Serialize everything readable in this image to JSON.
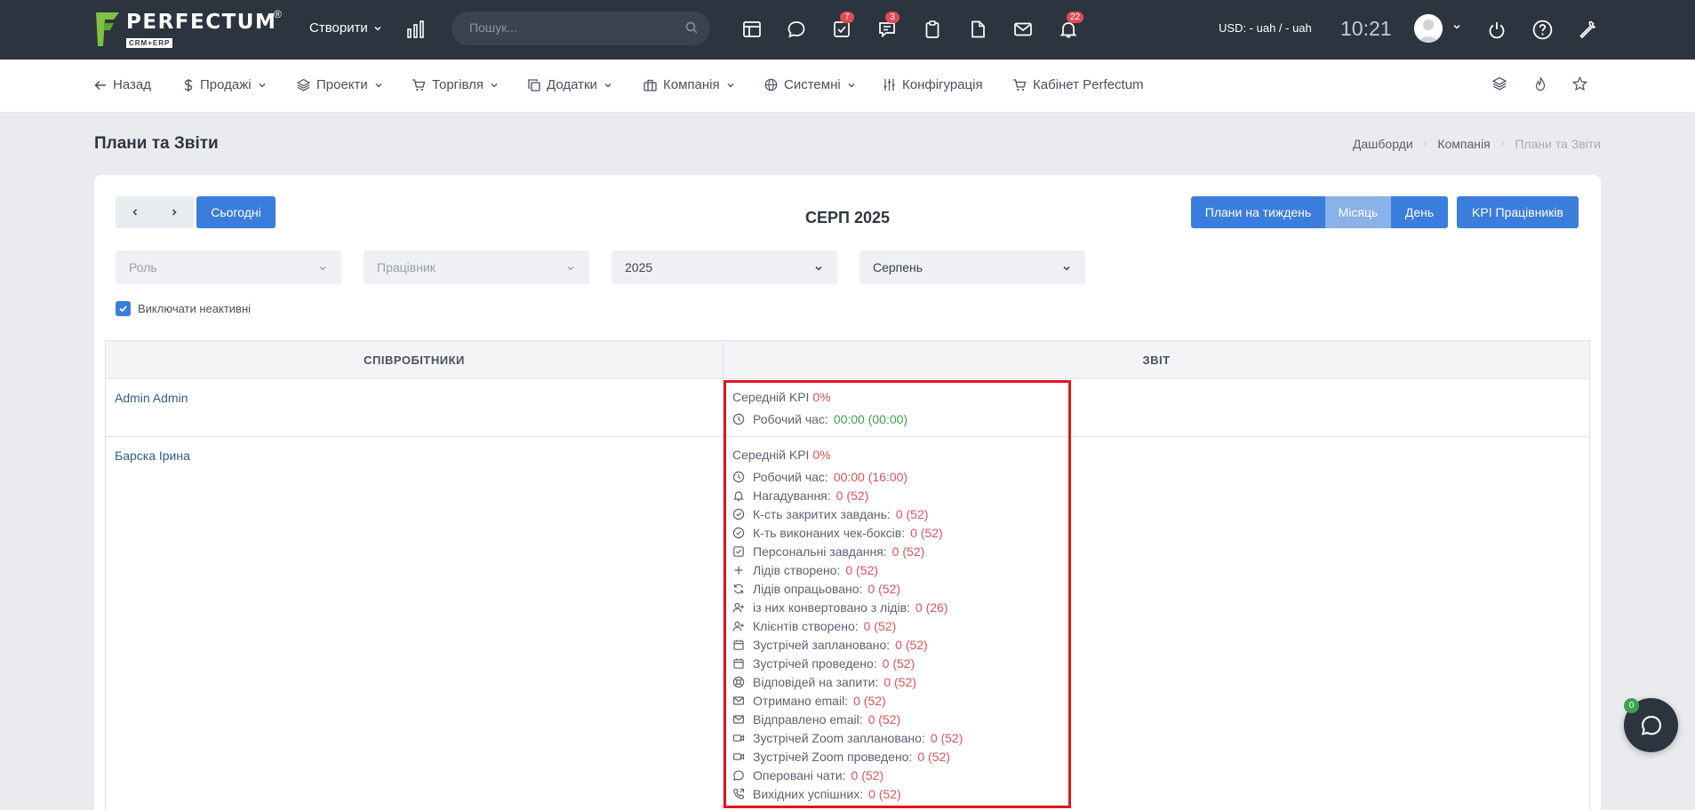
{
  "topbar": {
    "logo_text": "PERFECTUM",
    "logo_reg": "®",
    "logo_sub": "CRM+ERP",
    "create_label": "Створити",
    "search_placeholder": "Пошук...",
    "icons": [
      {
        "name": "table-icon",
        "badge": ""
      },
      {
        "name": "chat-bubble-icon",
        "badge": ""
      },
      {
        "name": "task-check-icon",
        "badge": "7"
      },
      {
        "name": "discussion-icon",
        "badge": "3"
      },
      {
        "name": "clipboard-icon",
        "badge": ""
      },
      {
        "name": "document-icon",
        "badge": ""
      },
      {
        "name": "mail-icon",
        "badge": ""
      },
      {
        "name": "bell-icon",
        "badge": "22"
      }
    ],
    "currency": "USD: - uah / - uah",
    "time": "10:21"
  },
  "nav": {
    "items": [
      {
        "label": "Назад",
        "icon": "arrow-left-icon"
      },
      {
        "label": "Продажі",
        "icon": "dollar-icon"
      },
      {
        "label": "Проекти",
        "icon": "layers-icon"
      },
      {
        "label": "Торгівля",
        "icon": "cart-icon"
      },
      {
        "label": "Додатки",
        "icon": "copy-icon"
      },
      {
        "label": "Компанія",
        "icon": "briefcase-icon"
      },
      {
        "label": "Системні",
        "icon": "globe-icon"
      },
      {
        "label": "Конфігурація",
        "icon": "sliders-icon"
      },
      {
        "label": "Кабінет Perfectum",
        "icon": "cart-icon"
      }
    ]
  },
  "page": {
    "title": "Плани та Звіти",
    "breadcrumb": [
      "Дашборди",
      "Компанія",
      "Плани та Звіти"
    ]
  },
  "controls": {
    "today_label": "Сьогодні",
    "month_title": "СЕРП 2025",
    "view_buttons": [
      "Плани на тиждень",
      "Місяць",
      "День"
    ],
    "kpi_button": "KPI Працівників",
    "filters": {
      "role_placeholder": "Роль",
      "employee_placeholder": "Працівник",
      "year": "2025",
      "month": "Серпень"
    },
    "exclude_inactive_label": "Виключати неактивні"
  },
  "table": {
    "headers": [
      "СПІВРОБІТНИКИ",
      "ЗВІТ"
    ],
    "rows": [
      {
        "name": "Admin Admin",
        "kpi_label": "Середній KPI",
        "kpi_value": "0%",
        "metrics": [
          {
            "icon": "clock-icon",
            "label": "Робочий час:",
            "value": "00:00 (00:00)",
            "color": "green"
          }
        ]
      },
      {
        "name": "Барска Ірина",
        "kpi_label": "Середній KPI",
        "kpi_value": "0%",
        "metrics": [
          {
            "icon": "clock-icon",
            "label": "Робочий час:",
            "value": "00:00 (16:00)",
            "color": "red"
          },
          {
            "icon": "bell-icon",
            "label": "Нагадування:",
            "value": "0 (52)",
            "color": "red"
          },
          {
            "icon": "check-circle-icon",
            "label": "К-сть закритих завдань:",
            "value": "0 (52)",
            "color": "red"
          },
          {
            "icon": "check-circle-icon",
            "label": "К-ть виконаних чек-боксів:",
            "value": "0 (52)",
            "color": "red"
          },
          {
            "icon": "check-square-icon",
            "label": "Персональні завдання:",
            "value": "0 (52)",
            "color": "red"
          },
          {
            "icon": "plus-icon",
            "label": "Лідів створено:",
            "value": "0 (52)",
            "color": "red"
          },
          {
            "icon": "refresh-icon",
            "label": "Лідів опрацьовано:",
            "value": "0 (52)",
            "color": "red"
          },
          {
            "icon": "user-plus-icon",
            "label": "із них конвертовано з лідів:",
            "value": "0 (26)",
            "color": "red"
          },
          {
            "icon": "user-plus-icon",
            "label": "Клієнтів створено:",
            "value": "0 (52)",
            "color": "red"
          },
          {
            "icon": "calendar-icon",
            "label": "Зустрічей заплановано:",
            "value": "0 (52)",
            "color": "red"
          },
          {
            "icon": "calendar-icon",
            "label": "Зустрічей проведено:",
            "value": "0 (52)",
            "color": "red"
          },
          {
            "icon": "lifebuoy-icon",
            "label": "Відповідей на запити:",
            "value": "0 (52)",
            "color": "red"
          },
          {
            "icon": "mail-icon",
            "label": "Отримано email:",
            "value": "0 (52)",
            "color": "red"
          },
          {
            "icon": "mail-icon",
            "label": "Відправлено email:",
            "value": "0 (52)",
            "color": "red"
          },
          {
            "icon": "video-icon",
            "label": "Зустрічей Zoom заплановано:",
            "value": "0 (52)",
            "color": "red"
          },
          {
            "icon": "video-icon",
            "label": "Зустрічей Zoom проведено:",
            "value": "0 (52)",
            "color": "red"
          },
          {
            "icon": "chat-icon",
            "label": "Оперовані чати:",
            "value": "0 (52)",
            "color": "red"
          },
          {
            "icon": "phone-outgoing-icon",
            "label": "Вихідних успішних:",
            "value": "0 (52)",
            "color": "red"
          }
        ]
      }
    ]
  },
  "chat_widget": {
    "badge": "0"
  },
  "colors": {
    "accent": "#3b7ddd",
    "topbar": "#2c3440",
    "danger": "#e0525b",
    "success": "#3aa24c",
    "highlight": "#e0161d"
  }
}
